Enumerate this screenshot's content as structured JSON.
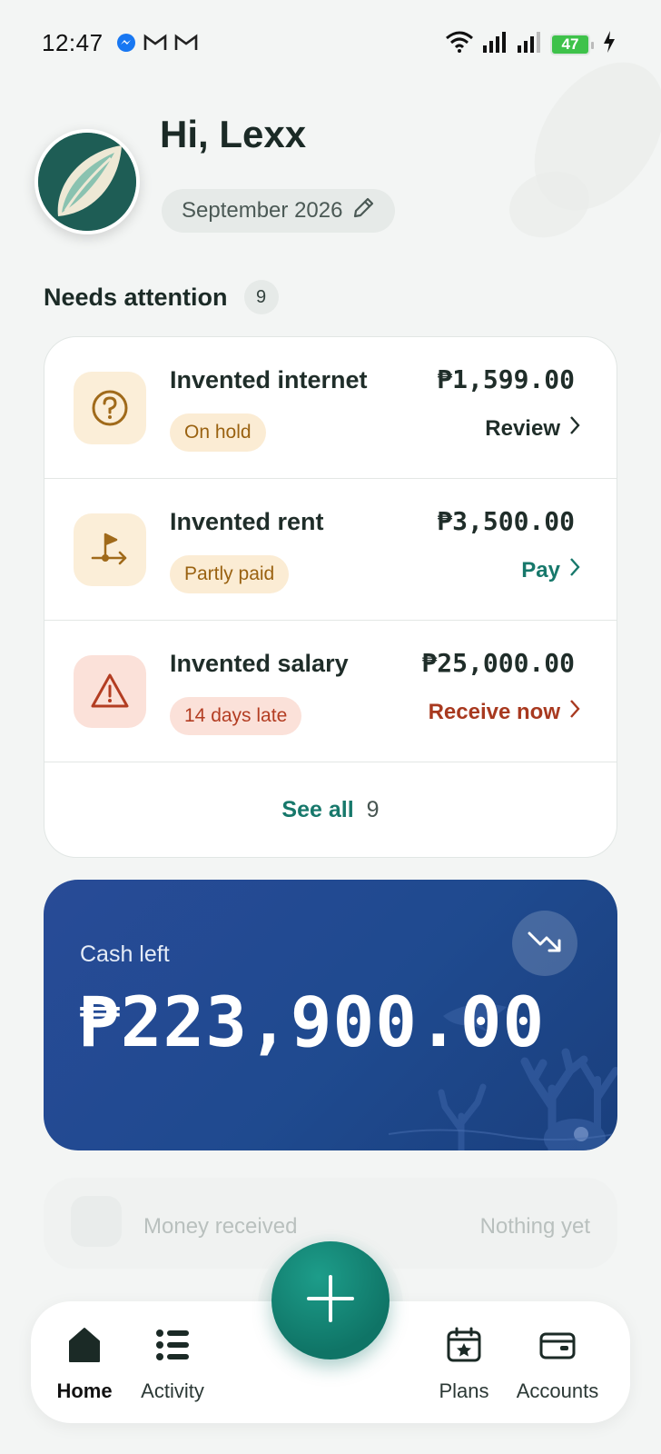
{
  "status_bar": {
    "time": "12:47",
    "battery": "47",
    "notif_icons": [
      "messenger-icon",
      "gmail-icon",
      "gmail-icon"
    ],
    "right_icons": [
      "wifi-icon",
      "signal-icon",
      "signal-icon",
      "battery-icon",
      "charging-icon"
    ]
  },
  "header": {
    "greeting": "Hi, Lexx",
    "month": "September 2026"
  },
  "needs_attention": {
    "title": "Needs attention",
    "count": "9",
    "items": [
      {
        "name": "Invented internet",
        "badge": "On hold",
        "amount": "₱1,599.00",
        "action": "Review",
        "icon": "question-icon",
        "action_color": "#1f2d29"
      },
      {
        "name": "Invented rent",
        "badge": "Partly paid",
        "amount": "₱3,500.00",
        "action": "Pay",
        "icon": "flag-route-icon",
        "action_color": "#17786b"
      },
      {
        "name": "Invented salary",
        "badge": "14 days late",
        "amount": "₱25,000.00",
        "action": "Receive now",
        "icon": "warning-icon",
        "action_color": "#a8391f"
      }
    ],
    "see_all_label": "See all",
    "see_all_count": "9"
  },
  "cash_card": {
    "label": "Cash left",
    "amount": "₱223,900.00"
  },
  "faded_row": {
    "label": "Money received",
    "value": "Nothing yet"
  },
  "bottom_nav": {
    "items": [
      {
        "label": "Home",
        "icon": "home-icon",
        "active": true
      },
      {
        "label": "Activity",
        "icon": "list-icon",
        "active": false
      },
      {
        "label": "Plans",
        "icon": "calendar-star-icon",
        "active": false
      },
      {
        "label": "Accounts",
        "icon": "wallet-icon",
        "active": false
      }
    ],
    "fab_icon": "plus-icon"
  },
  "colors": {
    "accent": "#17786b",
    "danger": "#a8391f",
    "card_blue": "#284b97"
  }
}
